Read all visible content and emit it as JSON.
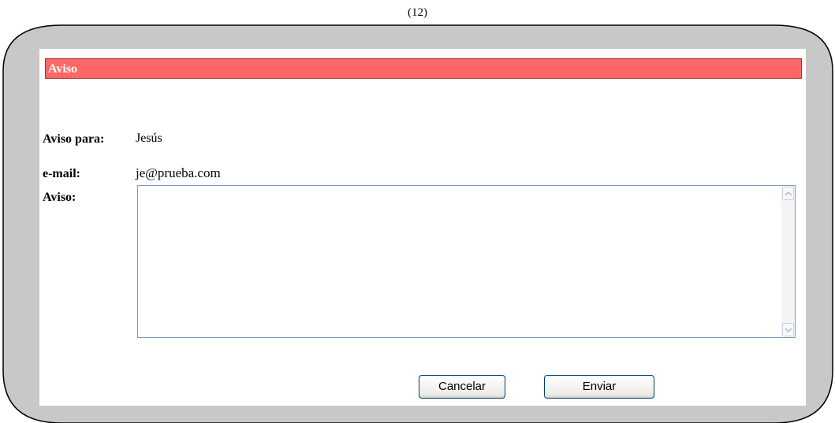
{
  "figure_number": "(12)",
  "header": {
    "title": "Aviso"
  },
  "fields": {
    "recipient_label": "Aviso para:",
    "recipient_value": "Jesús",
    "email_label": "e-mail:",
    "email_value": "je@prueba.com",
    "message_label": "Aviso:",
    "message_value": ""
  },
  "buttons": {
    "cancel_label": "Cancelar",
    "send_label": "Enviar"
  },
  "colors": {
    "header_bar": "#ff6666",
    "frame_border": "#000000",
    "frame_fill": "#c8c8c8"
  },
  "icons": [
    "scroll-up-icon",
    "scroll-down-icon"
  ]
}
